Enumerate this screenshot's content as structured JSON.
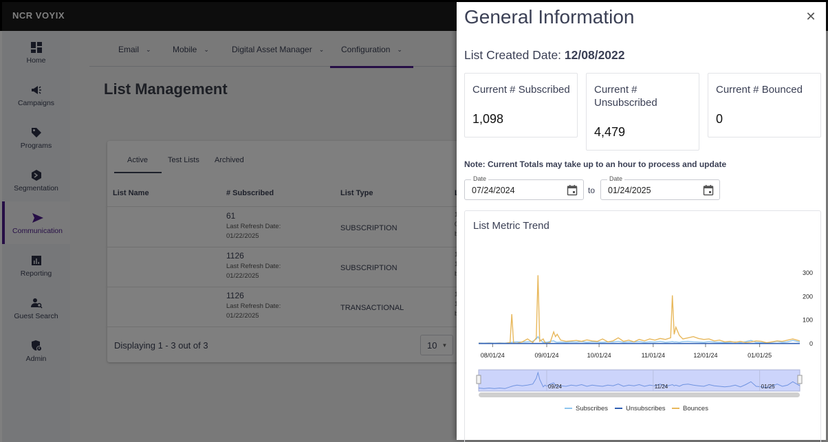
{
  "app": {
    "logo": "NCR VOYIX"
  },
  "sidebar": {
    "items": [
      {
        "label": "Home",
        "icon": "grid-icon",
        "active": false
      },
      {
        "label": "Campaigns",
        "icon": "megaphone-icon",
        "active": false
      },
      {
        "label": "Programs",
        "icon": "tag-icon",
        "active": false
      },
      {
        "label": "Segmentation",
        "icon": "hexagon-icon",
        "active": false
      },
      {
        "label": "Communication",
        "icon": "send-icon",
        "active": true
      },
      {
        "label": "Reporting",
        "icon": "bar-chart-icon",
        "active": false
      },
      {
        "label": "Guest Search",
        "icon": "user-search-icon",
        "active": false
      },
      {
        "label": "Admin",
        "icon": "shield-admin-icon",
        "active": false
      }
    ]
  },
  "topnav": {
    "items": [
      {
        "label": "Email",
        "active": false
      },
      {
        "label": "Mobile",
        "active": false
      },
      {
        "label": "Digital Asset Manager",
        "active": false
      },
      {
        "label": "Configuration",
        "active": true
      }
    ]
  },
  "page": {
    "title": "List Management",
    "tabs": [
      {
        "label": "Active",
        "active": true
      },
      {
        "label": "Test Lists",
        "active": false
      },
      {
        "label": "Archived",
        "active": false
      }
    ],
    "table": {
      "columns": [
        "List Name",
        "# Subscribed",
        "List Type",
        "L"
      ],
      "rows": [
        {
          "name": "",
          "subscribed": "61",
          "refresh_label": "Last Refresh Date:",
          "refresh_date": "01/22/2025",
          "type": "SUBSCRIPTION",
          "cut": [
            "1",
            "0",
            "b"
          ]
        },
        {
          "name": "",
          "subscribed": "1126",
          "refresh_label": "Last Refresh Date:",
          "refresh_date": "01/22/2025",
          "type": "SUBSCRIPTION",
          "cut": [
            "1",
            "1",
            "b"
          ]
        },
        {
          "name": "",
          "subscribed": "1126",
          "refresh_label": "Last Refresh Date:",
          "refresh_date": "01/22/2025",
          "type": "TRANSACTIONAL",
          "cut": [
            "1",
            "1",
            "b"
          ]
        }
      ]
    },
    "footer": {
      "displaying": "Displaying 1 - 3 out of 3",
      "page_size": "10"
    }
  },
  "drawer": {
    "title": "General Information",
    "close_icon": "close-icon",
    "created_label": "List Created Date:",
    "created_value": "12/08/2022",
    "metrics": [
      {
        "label": "Current # Subscribed",
        "value": "1,098"
      },
      {
        "label": "Current # Unsubscribed",
        "value": "4,479"
      },
      {
        "label": "Current # Bounced",
        "value": "0"
      }
    ],
    "note": "Note: Current Totals may take up to an hour to process and update",
    "date_from": {
      "label": "Date",
      "value": "07/24/2024"
    },
    "to_label": "to",
    "date_to": {
      "label": "Date",
      "value": "01/24/2025"
    }
  },
  "colors": {
    "accent": "#4c1c8c",
    "subscribes": "#8ec5ef",
    "unsubscribes": "#2f5fb3",
    "bounces": "#e8b85c",
    "navigator_fill": "#ccd4fb"
  },
  "chart_data": {
    "type": "line",
    "title": "List Metric Trend",
    "xlabel": "",
    "ylabel": "",
    "x_range": [
      "07/24/24",
      "01/24/25"
    ],
    "ylim": [
      0,
      300
    ],
    "y_ticks": [
      "0",
      "100",
      "200",
      "300"
    ],
    "y_axis_side": "right",
    "x_ticks": [
      "08/01/24",
      "09/01/24",
      "10/01/24",
      "11/01/24",
      "12/01/24",
      "01/01/25"
    ],
    "navigator_ticks": [
      "09/24",
      "11/24",
      "01/25"
    ],
    "legend": [
      "Subscribes",
      "Unsubscribes",
      "Bounces"
    ],
    "legend_position": "bottom",
    "grid": false,
    "x_days_from_start": [
      0,
      3,
      6,
      9,
      12,
      15,
      18,
      19,
      20,
      22,
      25,
      28,
      31,
      33,
      34,
      35,
      37,
      38,
      39,
      41,
      43,
      44,
      45,
      47,
      50,
      53,
      56,
      59,
      62,
      65,
      68,
      71,
      74,
      77,
      80,
      83,
      86,
      89,
      92,
      95,
      98,
      101,
      104,
      107,
      110,
      111,
      112,
      113,
      115,
      117,
      120,
      123,
      126,
      129,
      132,
      135,
      138,
      141,
      144,
      147,
      150,
      153,
      156,
      159,
      162,
      165,
      168,
      171,
      174,
      177,
      180,
      184
    ],
    "series": [
      {
        "name": "Subscribes",
        "values": [
          3,
          2,
          3,
          2,
          3,
          2,
          5,
          6,
          7,
          8,
          7,
          8,
          10,
          20,
          30,
          18,
          5,
          8,
          6,
          10,
          12,
          8,
          6,
          7,
          6,
          8,
          7,
          9,
          6,
          8,
          7,
          6,
          8,
          7,
          10,
          6,
          8,
          7,
          9,
          6,
          8,
          7,
          10,
          6,
          8,
          9,
          7,
          8,
          6,
          9,
          10,
          8,
          7,
          6,
          9,
          7,
          6,
          5,
          6,
          8,
          5,
          9,
          14,
          6,
          5,
          4,
          6,
          10,
          6,
          8,
          14,
          7
        ]
      },
      {
        "name": "Unsubscribes",
        "values": [
          1,
          1,
          1,
          1,
          1,
          1,
          1,
          1,
          1,
          1,
          1,
          1,
          1,
          1,
          1,
          1,
          1,
          1,
          1,
          1,
          1,
          1,
          1,
          1,
          1,
          1,
          1,
          1,
          1,
          1,
          1,
          1,
          1,
          1,
          1,
          1,
          1,
          1,
          1,
          1,
          1,
          1,
          1,
          1,
          1,
          1,
          1,
          1,
          1,
          1,
          1,
          1,
          1,
          1,
          1,
          1,
          1,
          1,
          1,
          1,
          1,
          1,
          1,
          1,
          1,
          1,
          1,
          1,
          1,
          1,
          1,
          1
        ]
      },
      {
        "name": "Bounces",
        "values": [
          2,
          1,
          2,
          1,
          2,
          1,
          5,
          125,
          3,
          2,
          8,
          20,
          5,
          25,
          290,
          10,
          20,
          4,
          2,
          6,
          50,
          30,
          40,
          15,
          10,
          12,
          14,
          10,
          16,
          12,
          10,
          20,
          8,
          12,
          25,
          10,
          15,
          8,
          18,
          12,
          20,
          15,
          22,
          18,
          25,
          205,
          40,
          70,
          35,
          20,
          25,
          30,
          22,
          18,
          20,
          12,
          15,
          8,
          10,
          6,
          10,
          5,
          8,
          12,
          10,
          4,
          8,
          12,
          10,
          15,
          20,
          12
        ]
      }
    ]
  }
}
